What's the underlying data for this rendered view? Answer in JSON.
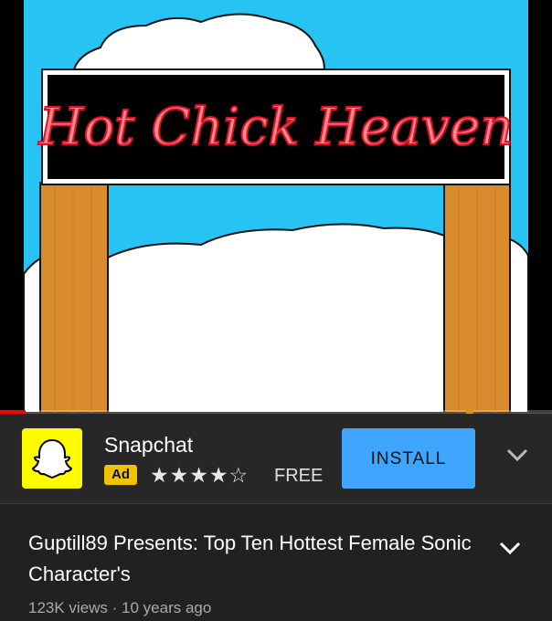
{
  "video": {
    "sign_text": "Hot Chick Heaven",
    "progress_fraction": 0.047
  },
  "ad": {
    "app_name": "Snapchat",
    "badge": "Ad",
    "rating": 4,
    "rating_max": 5,
    "stars_text": "★★★★☆",
    "price": "FREE",
    "install_label": "INSTALL",
    "logo_icon": "snapchat-ghost-icon",
    "more_icon": "chevron-down-icon",
    "colors": {
      "logo_bg": "#fffc00",
      "install_bg": "#3ea6ff",
      "badge_bg": "#f2c300"
    }
  },
  "video_info": {
    "title": "Guptill89 Presents: Top Ten Hottest Female Sonic Character's",
    "meta": "123K views · 10 years ago",
    "expand_icon": "chevron-down-icon"
  }
}
